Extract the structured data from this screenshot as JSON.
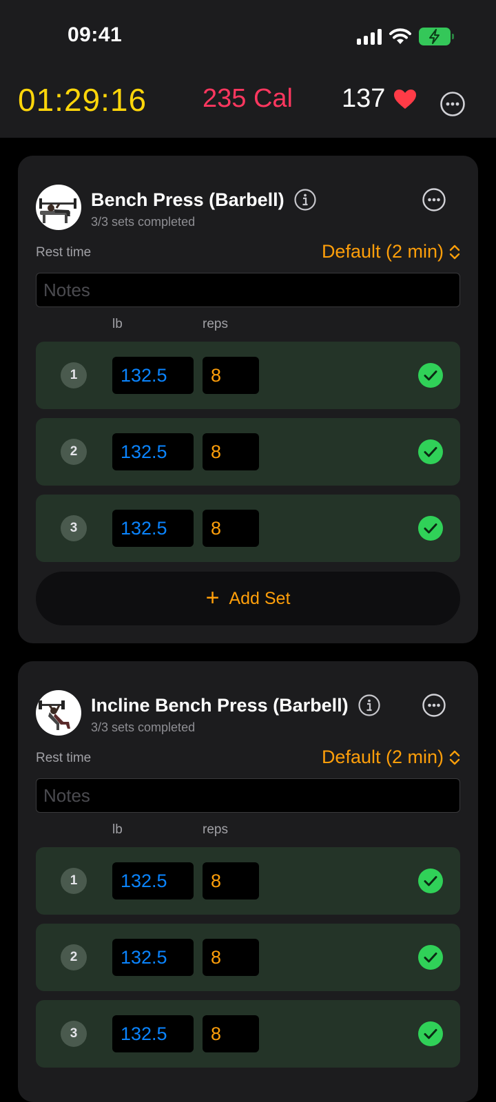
{
  "status_bar": {
    "time": "09:41",
    "icons": [
      "cellular-signal-icon",
      "wifi-icon",
      "battery-charging-icon"
    ]
  },
  "workout_metrics": {
    "elapsed": "01:29:16",
    "calories": "235 Cal",
    "heart_rate": "137",
    "icons": [
      "heart-icon",
      "more-icon"
    ]
  },
  "labels": {
    "rest_time": "Rest time",
    "notes_placeholder": "Notes",
    "col_weight": "lb",
    "col_reps": "reps",
    "add_set": "Add Set"
  },
  "exercises": [
    {
      "name": "Bench Press (Barbell)",
      "progress": "3/3 sets completed",
      "rest": "Default (2 min)",
      "sets": [
        {
          "num": "1",
          "weight": "132.5",
          "reps": "8",
          "completed": true
        },
        {
          "num": "2",
          "weight": "132.5",
          "reps": "8",
          "completed": true
        },
        {
          "num": "3",
          "weight": "132.5",
          "reps": "8",
          "completed": true
        }
      ]
    },
    {
      "name": "Incline Bench Press (Barbell)",
      "progress": "3/3 sets completed",
      "rest": "Default (2 min)",
      "sets": [
        {
          "num": "1",
          "weight": "132.5",
          "reps": "8",
          "completed": true
        },
        {
          "num": "2",
          "weight": "132.5",
          "reps": "8",
          "completed": true
        },
        {
          "num": "3",
          "weight": "132.5",
          "reps": "8",
          "completed": true
        }
      ]
    }
  ],
  "colors": {
    "timer": "#ffd60a",
    "calories": "#ff375f",
    "accent_orange": "#ff9f0a",
    "weight_blue": "#0a84ff",
    "check_green": "#30d158",
    "completed_row": "#243428"
  }
}
